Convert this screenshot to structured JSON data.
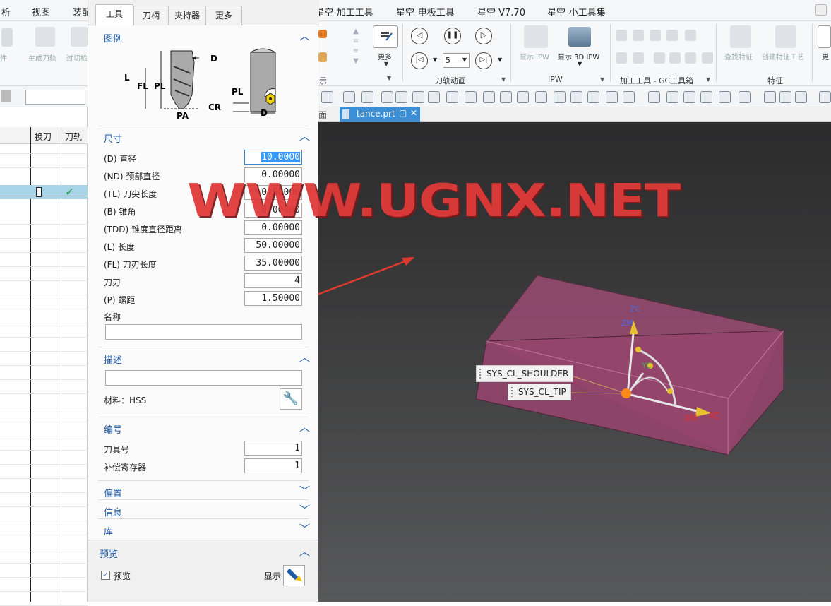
{
  "menubar": {
    "items": [
      "析",
      "视图",
      "装配",
      "星空-加工工具",
      "星空-电极工具",
      "星空 V7.70",
      "星空-小工具集"
    ]
  },
  "ribbon": {
    "left_labels": [
      "件",
      "生成刀轨",
      "过切检"
    ],
    "more_label": "更多",
    "anim_select": "5",
    "groups": [
      "示",
      "刀轨动画",
      "IPW",
      "加工工具 - GC工具箱",
      "特征"
    ],
    "ipw_show": "显示 IPW",
    "ipw_show3d": "显示 3D IPW",
    "feat_find": "查找特征",
    "feat_create": "创建特征工艺",
    "far_right": "更"
  },
  "navigator": {
    "col_change": "换刀",
    "col_path": "刀轨",
    "row_check": "✓"
  },
  "dialog": {
    "tabs": [
      "工具",
      "刀柄",
      "夹持器",
      "更多"
    ],
    "legend": {
      "title": "图例",
      "labels": {
        "D": "D",
        "L": "L",
        "FL": "FL",
        "PL": "PL",
        "CR": "CR",
        "PA": "PA",
        "PL2": "PL",
        "D2": "D"
      }
    },
    "dimensions": {
      "title": "尺寸",
      "fields": [
        {
          "label": "(D) 直径",
          "value": "10.0000"
        },
        {
          "label": "(ND) 颈部直径",
          "value": "0.00000"
        },
        {
          "label": "(TL) 刀尖长度",
          "value": "0.00000"
        },
        {
          "label": "(B) 锥角",
          "value": "0.00000"
        },
        {
          "label": "(TDD) 锥度直径距离",
          "value": "0.00000"
        },
        {
          "label": "(L) 长度",
          "value": "50.00000"
        },
        {
          "label": "(FL) 刀刃长度",
          "value": "35.00000"
        },
        {
          "label": "刀刃",
          "value": "4"
        },
        {
          "label": "(P) 螺距",
          "value": "1.50000"
        }
      ],
      "name_label": "名称",
      "name_value": ""
    },
    "description": {
      "title": "描述",
      "value": "",
      "material": "材料：HSS"
    },
    "numbering": {
      "title": "编号",
      "tool_number_label": "刀具号",
      "tool_number": "1",
      "comp_label": "补偿寄存器",
      "comp_value": "1"
    },
    "collapsed": [
      "偏置",
      "信息",
      "库"
    ],
    "preview": {
      "title": "预览",
      "checkbox_label": "预览",
      "show_label": "显示"
    }
  },
  "viewport": {
    "file_tab": "tance.prt",
    "file_tab_prefix": "面",
    "watermark": "WWW.UGNX.NET",
    "callouts": [
      "SYS_CL_SHOULDER",
      "SYS_CL_TIP"
    ],
    "axes": {
      "zc": "ZC",
      "zm": "ZM",
      "yc": "YC",
      "xm": "XM",
      "xc": "XC"
    },
    "colors": {
      "block": "#a8507c",
      "watermark": "#e03a3a"
    }
  }
}
